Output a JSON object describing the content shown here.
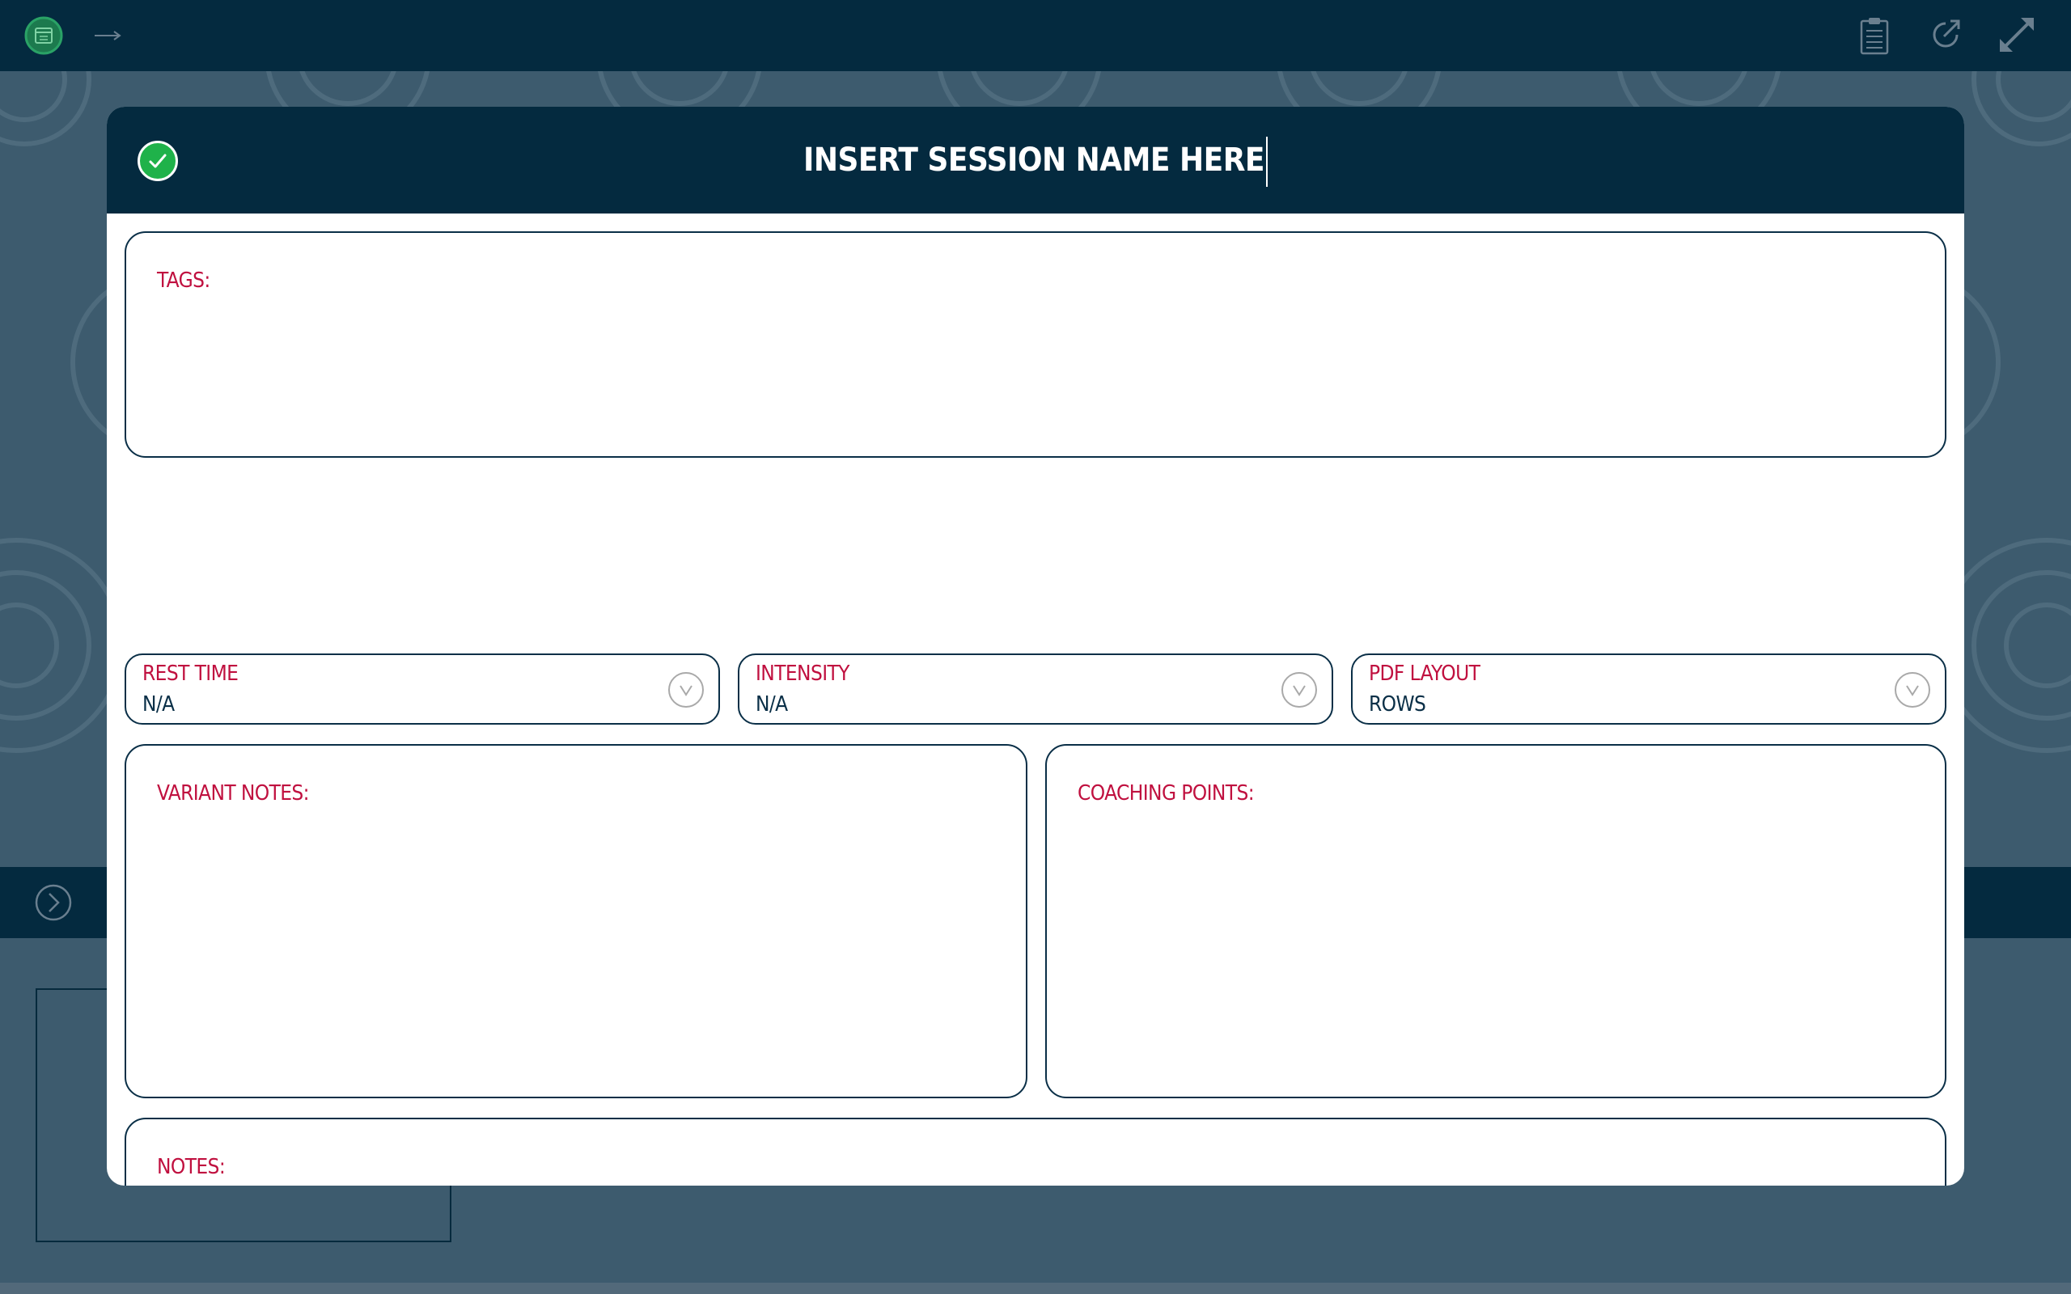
{
  "topbar": {
    "app_icon": "calendar-icon",
    "nav_icon": "arrow-right-icon",
    "right_icons": [
      "clipboard-icon",
      "share-icon",
      "expand-icon"
    ]
  },
  "midbar": {
    "toggle_icon": "chevron-right-circle-icon"
  },
  "modal": {
    "confirm_icon": "checkmark-icon",
    "session_name": "INSERT SESSION NAME HERE",
    "tags_label": "TAGS:",
    "selects": [
      {
        "label": "REST TIME",
        "value": "N/A"
      },
      {
        "label": "INTENSITY",
        "value": "N/A"
      },
      {
        "label": "PDF LAYOUT",
        "value": "ROWS"
      }
    ],
    "variant_notes_label": "VARIANT NOTES:",
    "coaching_points_label": "COACHING POINTS:",
    "notes_label": "NOTES:"
  },
  "colors": {
    "header_bg": "#042a3f",
    "page_bg": "#3d5b6e",
    "label_red": "#c0103f",
    "confirm_green": "#1fb24a",
    "border_navy": "#0a2f47"
  }
}
